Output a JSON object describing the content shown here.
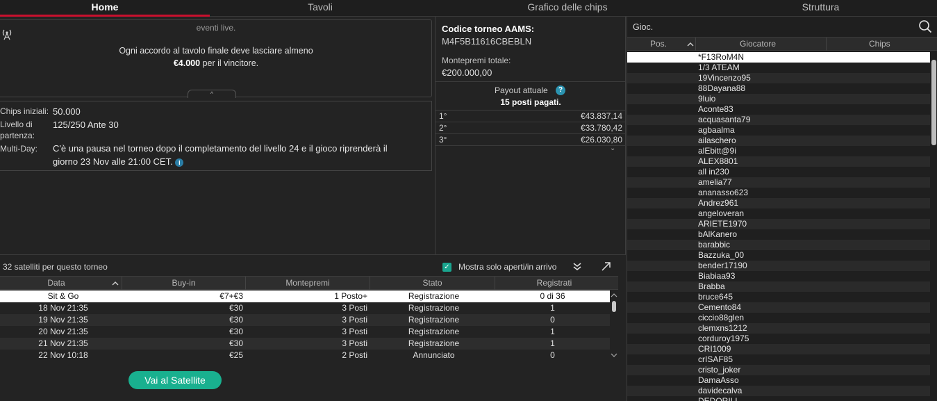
{
  "tabs": [
    "Home",
    "Tavoli",
    "Grafico delle chips",
    "Struttura"
  ],
  "info_top": {
    "faded_text": "eventi live.",
    "deal_line1": "Ogni accordo al tavolo finale deve lasciare almeno",
    "deal_amount": "€4.000",
    "deal_suffix": " per il vincitore.",
    "collapse_glyph": "^"
  },
  "info": {
    "chips_label": "Chips iniziali:",
    "chips_value": "50.000",
    "level_label1": "Livello di",
    "level_label2": "partenza:",
    "level_value": "125/250 Ante 30",
    "multiday_label": "Multi-Day:",
    "multiday_line1": "C'è una pausa nel torneo dopo il completamento del livello 24 e il gioco riprenderà il",
    "multiday_line2": "giorno 23 Nov alle 21:00 CET.",
    "info_glyph": "i"
  },
  "tournament": {
    "code_label": "Codice torneo AAMS:",
    "code_value": "M4F5B11616CBEBLN",
    "prize_label": "Montepremi totale:",
    "prize_value": "€200.000,00",
    "payout_label": "Payout attuale",
    "help_glyph": "?",
    "paid_label": "15 posti pagati.",
    "payouts": [
      {
        "pos": "1°",
        "amount": "€43.837,14"
      },
      {
        "pos": "2°",
        "amount": "€33.780,42"
      },
      {
        "pos": "3°",
        "amount": "€26.030,80"
      }
    ],
    "more_glyph": "⌄"
  },
  "satellites": {
    "title": "32 satelliti per questo torneo",
    "check_glyph": "✓",
    "filter_label": "Mostra solo aperti/in arrivo",
    "collapse_glyph": "≚",
    "columns": [
      "Data",
      "Buy-in",
      "Montepremi",
      "Stato",
      "Registrati"
    ],
    "sort_glyph": "⌃",
    "rows": [
      {
        "data": "Sit & Go",
        "buyin": "€7+€3",
        "prize": "1 Posto+",
        "stato": "Registrazione",
        "reg": "0 di 36"
      },
      {
        "data": "18 Nov  21:35",
        "buyin": "€30",
        "prize": "3 Posti",
        "stato": "Registrazione",
        "reg": "1"
      },
      {
        "data": "19 Nov  21:35",
        "buyin": "€30",
        "prize": "3 Posti",
        "stato": "Registrazione",
        "reg": "0"
      },
      {
        "data": "20 Nov  21:35",
        "buyin": "€30",
        "prize": "3 Posti",
        "stato": "Registrazione",
        "reg": "1"
      },
      {
        "data": "21 Nov  21:35",
        "buyin": "€30",
        "prize": "3 Posti",
        "stato": "Registrazione",
        "reg": "1"
      },
      {
        "data": "22 Nov  10:18",
        "buyin": "€25",
        "prize": "2 Posti",
        "stato": "Annunciato",
        "reg": "0"
      }
    ],
    "button_label": "Vai al Satellite"
  },
  "players": {
    "search_placeholder": "Gioc.",
    "columns": [
      "Pos.",
      "Giocatore",
      "Chips"
    ],
    "sort_glyph": "⌃",
    "list": [
      "*F13RoM4N",
      "1/3 ATEAM",
      "19Vincenzo95",
      "88Dayana88",
      "9luio",
      "Aconte83",
      "acquasanta79",
      "agbaalma",
      "ailaschero",
      "alEbitt@9i",
      "ALEX8801",
      "all in230",
      "amelia77",
      "ananasso623",
      "Andrez961",
      "angeloveran",
      "ARIETE1970",
      "bAlKanero",
      "barabbic",
      "Bazzuka_00",
      "bender17190",
      "Biabiaa93",
      "Brabba",
      "bruce645",
      "Cemento84",
      "ciccio88glen",
      "clemxns1212",
      "corduroy1975",
      "CRI1009",
      "crISAF85",
      "cristo_joker",
      "DamaAsso",
      "davidecalva",
      "DEDORILL"
    ]
  }
}
